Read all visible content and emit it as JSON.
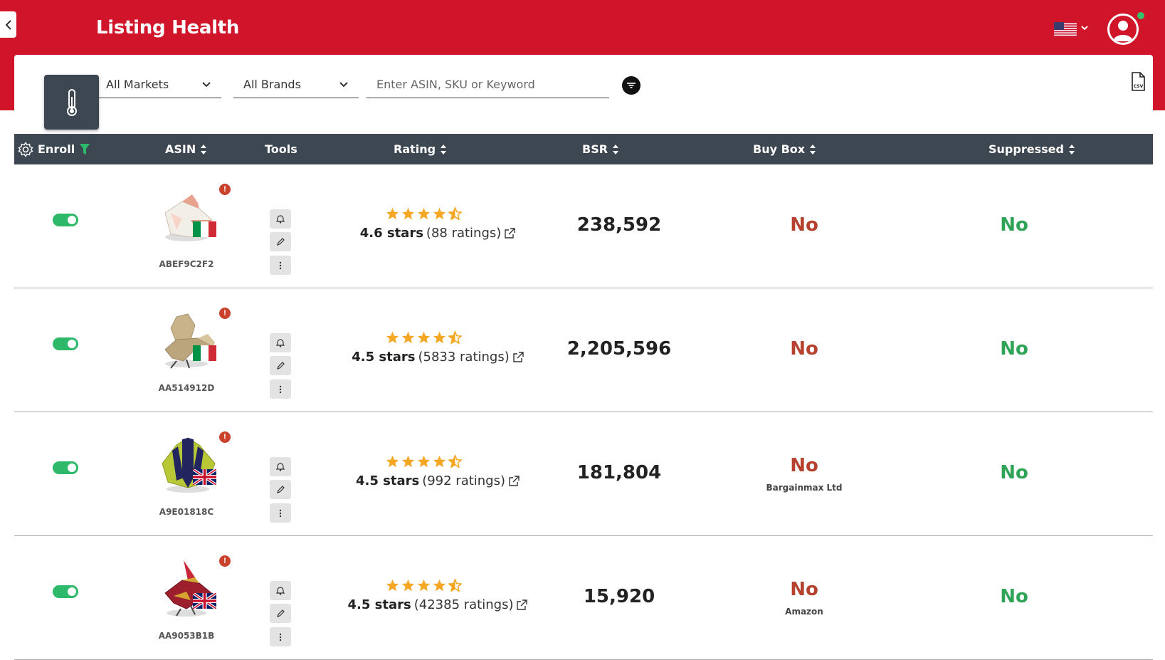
{
  "header": {
    "title": "Listing Health",
    "country_flag": "us-flag-icon",
    "colors": {
      "brand": "#d0152a",
      "header_dark": "#3d4752",
      "ok": "#2fa457",
      "bad": "#b5412e",
      "star": "#f5a623",
      "toggle": "#2db86a"
    }
  },
  "toolbar": {
    "markets": "All Markets",
    "brands": "All Brands",
    "search_placeholder": "Enter ASIN, SKU or Keyword"
  },
  "table": {
    "columns": {
      "enroll": "Enroll",
      "asin": "ASIN",
      "tools": "Tools",
      "rating": "Rating",
      "bsr": "BSR",
      "buybox": "Buy Box",
      "suppressed": "Suppressed"
    },
    "rows": [
      {
        "enrolled": true,
        "asin": "ABEF9C2F2",
        "flag": "italy",
        "stars_text": "4.6 stars",
        "ratings_text": "(88 ratings)",
        "bsr": "238,592",
        "buybox": "No",
        "seller": "",
        "suppressed": "No"
      },
      {
        "enrolled": true,
        "asin": "AA514912D",
        "flag": "italy",
        "stars_text": "4.5 stars",
        "ratings_text": "(5833 ratings)",
        "bsr": "2,205,596",
        "buybox": "No",
        "seller": "",
        "suppressed": "No"
      },
      {
        "enrolled": true,
        "asin": "A9E01818C",
        "flag": "uk",
        "stars_text": "4.5 stars",
        "ratings_text": "(992 ratings)",
        "bsr": "181,804",
        "buybox": "No",
        "seller": "Bargainmax Ltd",
        "suppressed": "No"
      },
      {
        "enrolled": true,
        "asin": "AA9053B1B",
        "flag": "uk",
        "stars_text": "4.5 stars",
        "ratings_text": "(42385 ratings)",
        "bsr": "15,920",
        "buybox": "No",
        "seller": "Amazon",
        "suppressed": "No"
      }
    ]
  }
}
